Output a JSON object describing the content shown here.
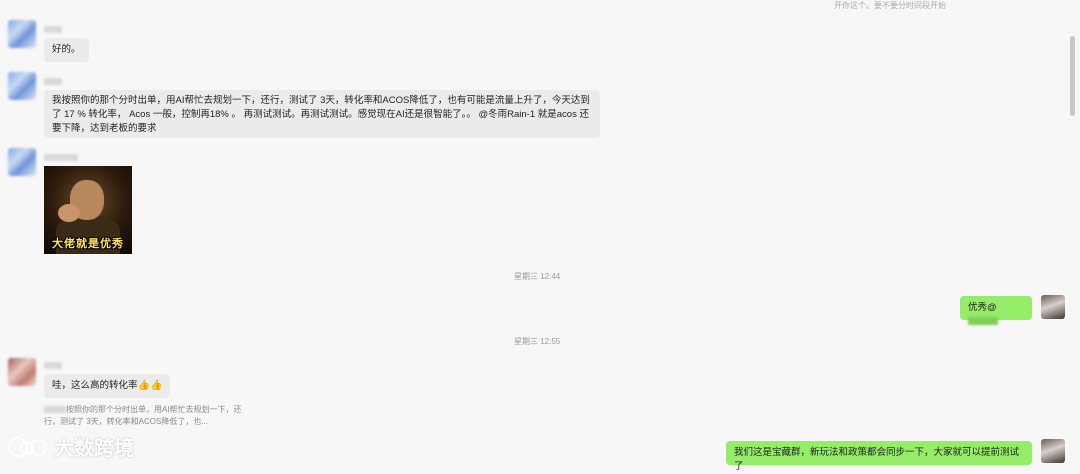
{
  "top_note": "开你这个。要不要分时间段开始",
  "messages": [
    {
      "text": "好的。"
    },
    {
      "text": "我按照你的那个分时出单，用AI帮忙去规划一下，还行，测试了 3天，转化率和ACOS降低了，也有可能是流量上升了，今天达到了 17 % 转化率， Acos 一般，控制再18% 。 再测试测试。再测试测试。感觉现在AI还是很智能了。。 @冬雨Rain-1 就是acos 还要下降，达到老板的要求"
    },
    {
      "sticker_caption": "大佬就是优秀"
    }
  ],
  "timestamps": [
    "星期三 12:44",
    "星期三 12:55"
  ],
  "self_messages": [
    {
      "text": "优秀@"
    },
    {
      "text": "我们这是宝藏群，新玩法和政策都会同步一下，大家就可以提前测试了"
    }
  ],
  "reply": {
    "text": "哇，这么高的转化率",
    "emoji": "👍👍",
    "quote_text": "按照你的那个分时出单，用AI帮忙去规划一下，还行，测试了 3天，转化率和ACOS降低了，也..."
  },
  "watermark": "大数跨境",
  "colors": {
    "self_bubble": "#95ec69",
    "other_bubble": "#ebebeb",
    "background": "#f7f7f7"
  }
}
